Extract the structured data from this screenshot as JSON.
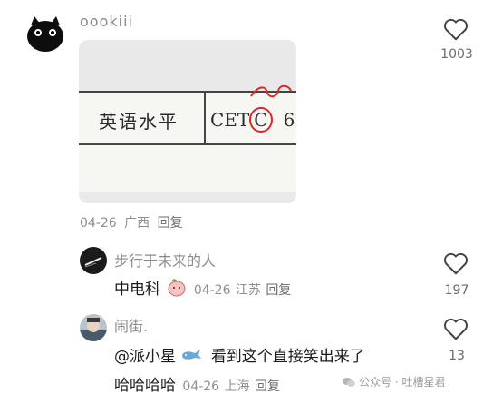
{
  "comment1": {
    "username": "oookiii",
    "likes": "1003",
    "image_text": {
      "label": "英语水平",
      "value_pre": "CET",
      "value_circled": "C",
      "value_post": "6"
    },
    "date": "04-26",
    "location": "广西",
    "reply_label": "回复"
  },
  "reply1": {
    "username": "步行于未来的人",
    "text": "中电科",
    "date": "04-26",
    "location": "江苏",
    "reply_label": "回复",
    "likes": "197"
  },
  "reply2": {
    "username": "闹街.",
    "mention": "@派小星",
    "text_line1": "看到这个直接笑出来了",
    "text_line2": "哈哈哈哈",
    "date": "04-26",
    "location": "上海",
    "reply_label": "回复",
    "likes": "13"
  },
  "watermark": {
    "text": "公众号 · 吐槽星君"
  },
  "icons": {
    "like": "heart-outline-icon",
    "emoji": "peach-face-emoji",
    "whale": "whale-emoji",
    "wechat": "wechat-icon"
  }
}
